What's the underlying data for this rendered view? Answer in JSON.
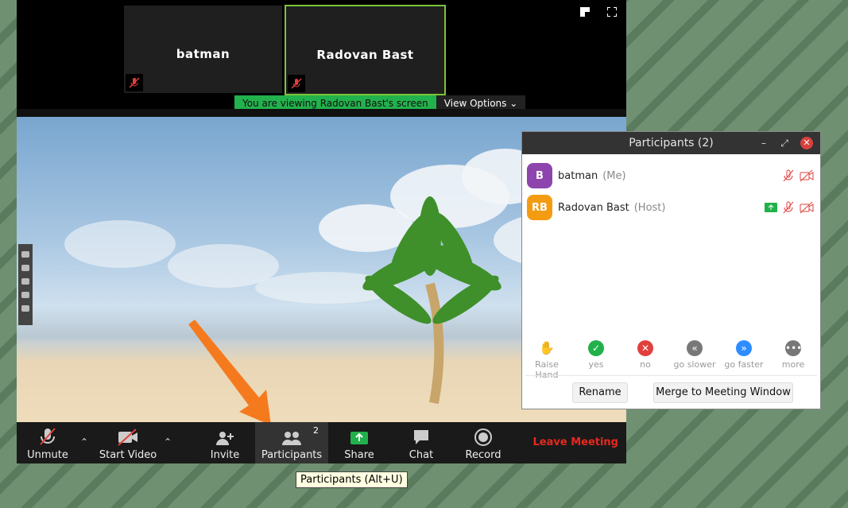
{
  "tiles": [
    {
      "name": "batman",
      "active": false
    },
    {
      "name": "Radovan Bast",
      "active": true
    }
  ],
  "viewing_banner": "You are viewing Radovan Bast's screen",
  "view_options": "View Options",
  "toolbar": {
    "unmute": "Unmute",
    "start_video": "Start Video",
    "invite": "Invite",
    "participants": "Participants",
    "participants_count": "2",
    "share": "Share",
    "chat": "Chat",
    "record": "Record",
    "leave": "Leave Meeting"
  },
  "tooltip": "Participants (Alt+U)",
  "participants_panel": {
    "title": "Participants (2)",
    "people": [
      {
        "initials": "B",
        "name": "batman",
        "tag": "(Me)",
        "color": "#8e44ad"
      },
      {
        "initials": "RB",
        "name": "Radovan Bast",
        "tag": "(Host)",
        "color": "#f39c12"
      }
    ],
    "reactions": [
      {
        "label": "Raise Hand",
        "icon": "hand-icon",
        "color": "#2d8cff"
      },
      {
        "label": "yes",
        "icon": "check-icon",
        "color": "#21b14b"
      },
      {
        "label": "no",
        "icon": "x-icon",
        "color": "#e0403b"
      },
      {
        "label": "go slower",
        "icon": "rewind-icon",
        "color": "#777777"
      },
      {
        "label": "go faster",
        "icon": "fast-forward-icon",
        "color": "#2d8cff"
      },
      {
        "label": "more",
        "icon": "more-icon",
        "color": "#777777"
      }
    ],
    "rename": "Rename",
    "merge": "Merge to Meeting Window"
  }
}
